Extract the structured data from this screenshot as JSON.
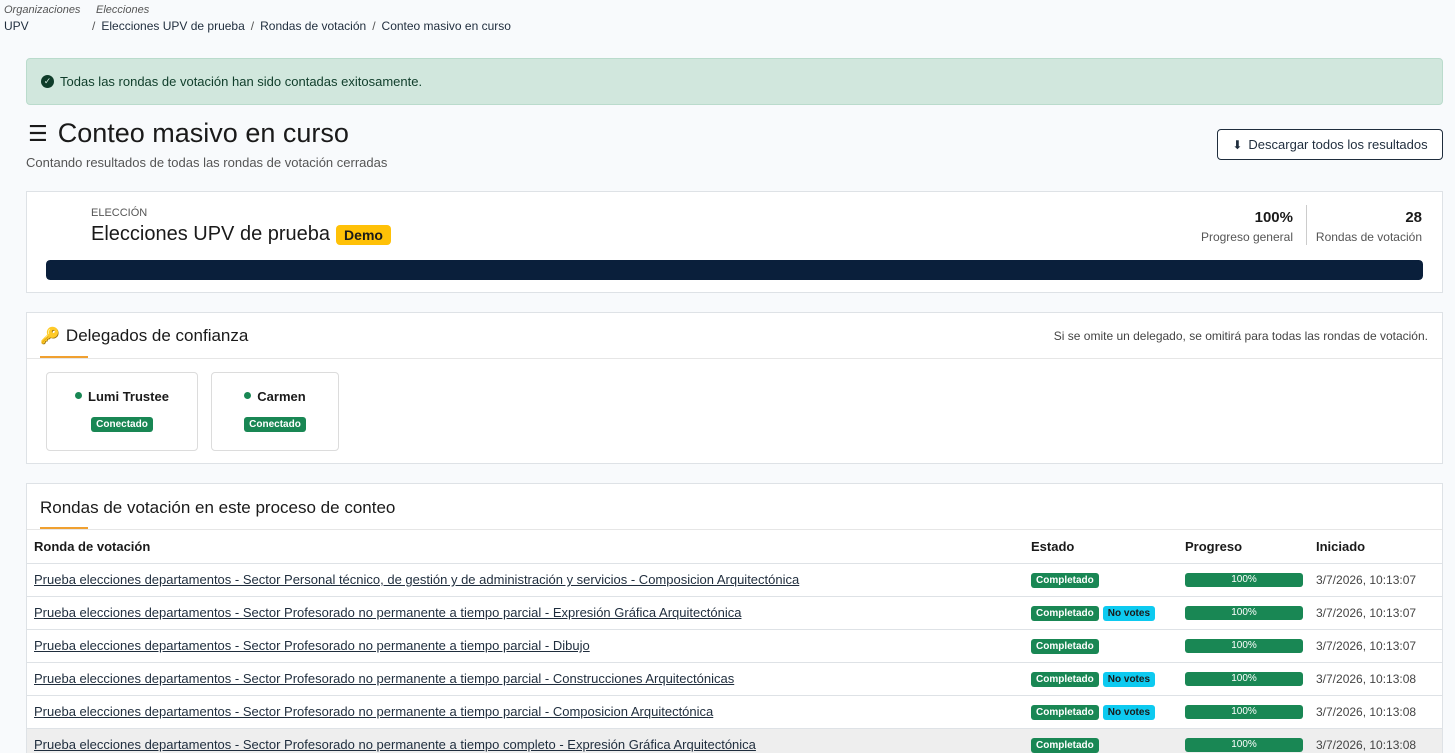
{
  "breadcrumb": {
    "org_label": "Organizaciones",
    "org_value": "UPV",
    "elections_label": "Elecciones",
    "items": [
      "Elecciones UPV de prueba",
      "Rondas de votación",
      "Conteo masivo en curso"
    ]
  },
  "alert": {
    "text": "Todas las rondas de votación han sido contadas exitosamente."
  },
  "header": {
    "title": "Conteo masivo en curso",
    "subtitle": "Contando resultados de todas las rondas de votación cerradas",
    "download_label": "Descargar todos los resultados"
  },
  "election": {
    "label": "ELECCIÓN",
    "name": "Elecciones UPV de prueba",
    "badge": "Demo",
    "progress_value": "100%",
    "progress_label": "Progreso general",
    "rounds_value": "28",
    "rounds_label": "Rondas de votación",
    "progress_fraction": 1.0
  },
  "trustees": {
    "title": "Delegados de confianza",
    "note": "Si se omite un delegado, se omitirá para todas las rondas de votación.",
    "items": [
      {
        "name": "Lumi Trustee",
        "status": "Conectado"
      },
      {
        "name": "Carmen",
        "status": "Conectado"
      }
    ]
  },
  "rounds": {
    "title": "Rondas de votación en este proceso de conteo",
    "columns": [
      "Ronda de votación",
      "Estado",
      "Progreso",
      "Iniciado"
    ],
    "rows": [
      {
        "name": "Prueba elecciones departamentos - Sector Personal técnico, de gestión y de administración y servicios - Composicion Arquitectónica",
        "status": "Completado",
        "extra": "",
        "progress": "100%",
        "started": "3/7/2026, 10:13:07"
      },
      {
        "name": "Prueba elecciones departamentos - Sector Profesorado no permanente a tiempo parcial - Expresión Gráfica Arquitectónica",
        "status": "Completado",
        "extra": "No votes",
        "progress": "100%",
        "started": "3/7/2026, 10:13:07"
      },
      {
        "name": "Prueba elecciones departamentos - Sector Profesorado no permanente a tiempo parcial - Dibujo",
        "status": "Completado",
        "extra": "",
        "progress": "100%",
        "started": "3/7/2026, 10:13:07"
      },
      {
        "name": "Prueba elecciones departamentos - Sector Profesorado no permanente a tiempo parcial - Construcciones Arquitectónicas",
        "status": "Completado",
        "extra": "No votes",
        "progress": "100%",
        "started": "3/7/2026, 10:13:08"
      },
      {
        "name": "Prueba elecciones departamentos - Sector Profesorado no permanente a tiempo parcial - Composicion Arquitectónica",
        "status": "Completado",
        "extra": "No votes",
        "progress": "100%",
        "started": "3/7/2026, 10:13:08"
      },
      {
        "name": "Prueba elecciones departamentos - Sector Profesorado no permanente a tiempo completo - Expresión Gráfica Arquitectónica",
        "status": "Completado",
        "extra": "",
        "progress": "100%",
        "started": "3/7/2026, 10:13:08"
      }
    ]
  }
}
